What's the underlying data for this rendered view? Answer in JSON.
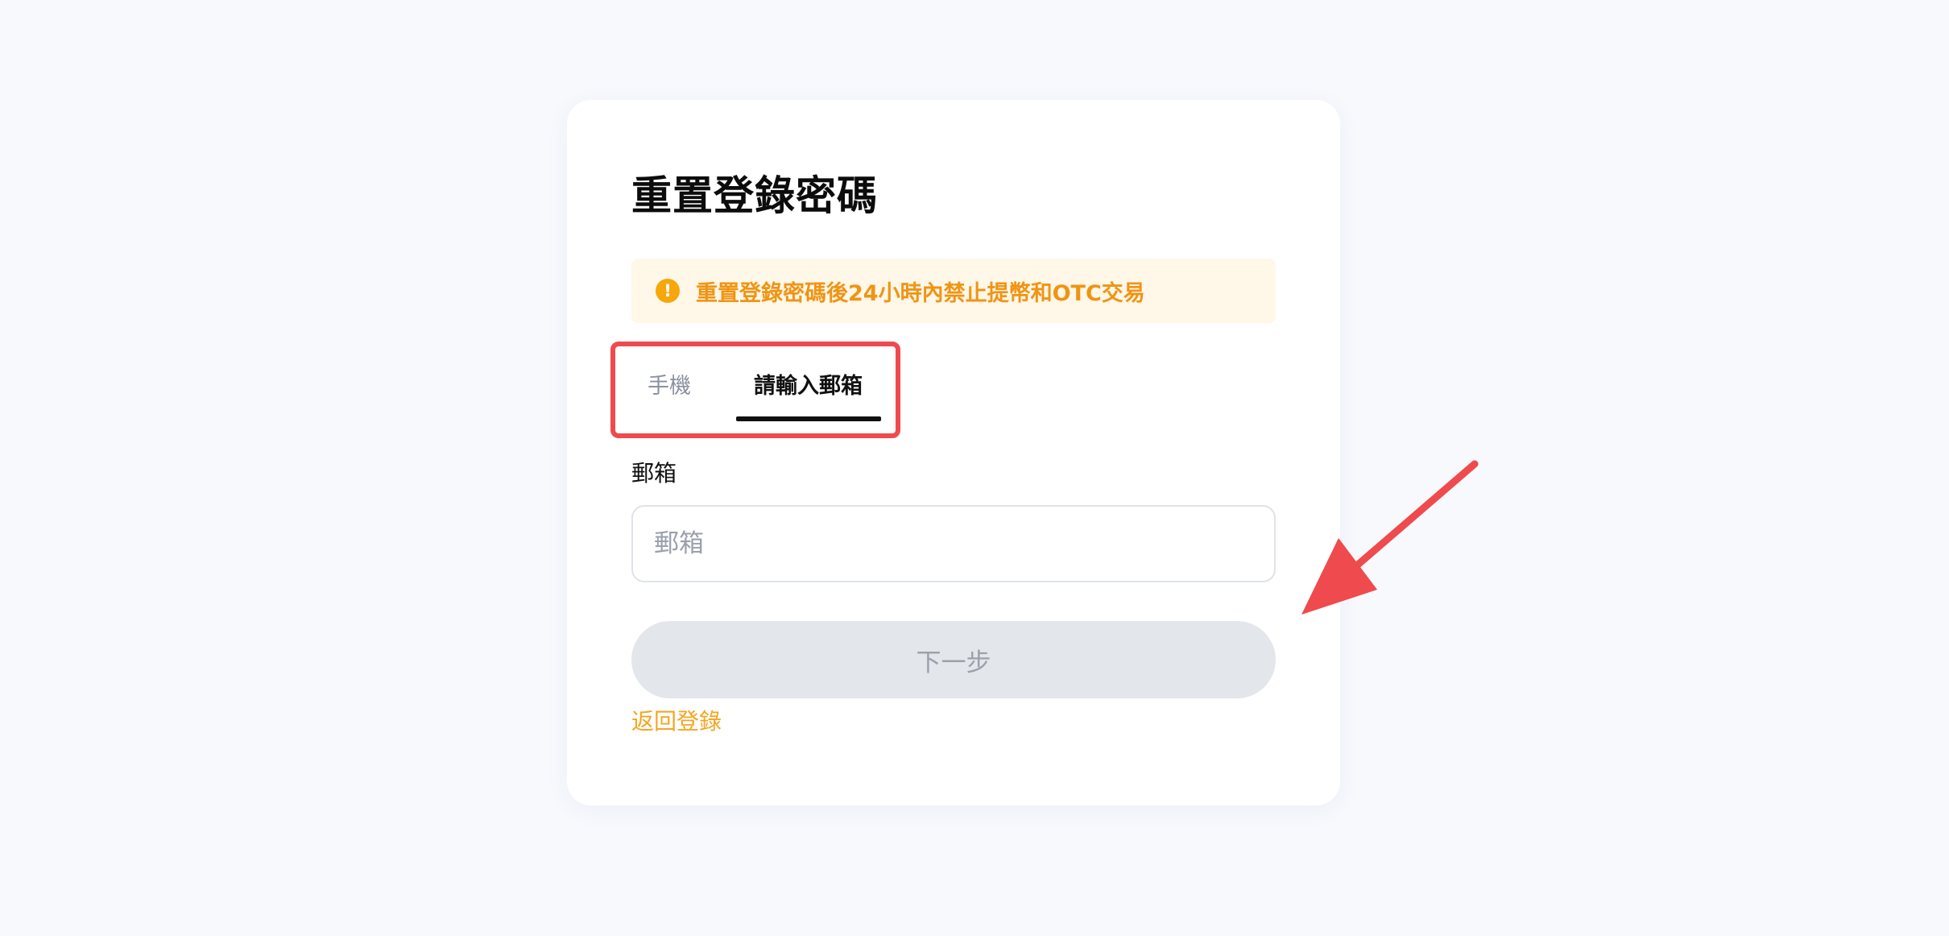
{
  "page": {
    "title": "重置登錄密碼"
  },
  "notice": {
    "icon": "exclamation-circle-icon",
    "icon_glyph": "!",
    "text": "重置登錄密碼後24小時內禁止提幣和OTC交易",
    "color": "#f09414"
  },
  "tabs": [
    {
      "label": "手機",
      "active": false
    },
    {
      "label": "請輸入郵箱",
      "active": true
    }
  ],
  "form": {
    "email_label": "郵箱",
    "email_value": "",
    "email_placeholder": "郵箱",
    "next_label": "下一步",
    "next_disabled": true
  },
  "footer": {
    "back_link": "返回登錄"
  },
  "annotations": {
    "highlight_color": "#ef4a4e",
    "arrow_icon": "red-pointer-arrow-icon"
  }
}
